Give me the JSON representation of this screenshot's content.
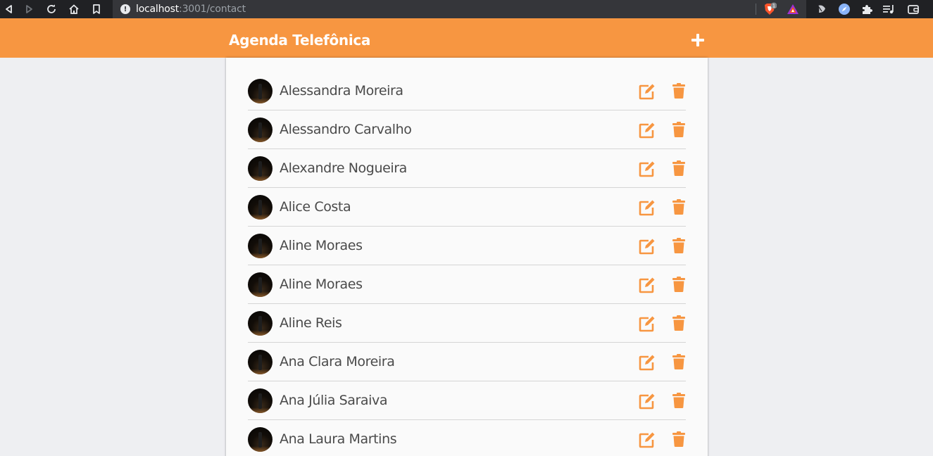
{
  "browser": {
    "url_host": "localhost",
    "url_rest": ":3001/contact",
    "icons": [
      "back-icon",
      "forward-icon",
      "reload-icon",
      "home-icon",
      "bookmark-icon",
      "site-info-icon",
      "brave-shields-icon",
      "brave-rewards-icon",
      "extension-leaf-icon",
      "extension-compass-icon",
      "extensions-puzzle-icon",
      "media-playlist-icon",
      "wallet-icon"
    ],
    "shields_badge": "1"
  },
  "app": {
    "title": "Agenda Telefônica",
    "accent_color": "#f79641",
    "add_icon": "plus-icon"
  },
  "contacts": [
    {
      "name": "Alessandra Moreira"
    },
    {
      "name": "Alessandro Carvalho"
    },
    {
      "name": "Alexandre Nogueira"
    },
    {
      "name": "Alice Costa"
    },
    {
      "name": "Aline Moraes"
    },
    {
      "name": "Aline Moraes"
    },
    {
      "name": "Aline Reis"
    },
    {
      "name": "Ana Clara Moreira"
    },
    {
      "name": "Ana Júlia Saraiva"
    },
    {
      "name": "Ana Laura Martins"
    }
  ],
  "row_icons": {
    "edit": "edit-icon",
    "delete": "trash-icon"
  }
}
